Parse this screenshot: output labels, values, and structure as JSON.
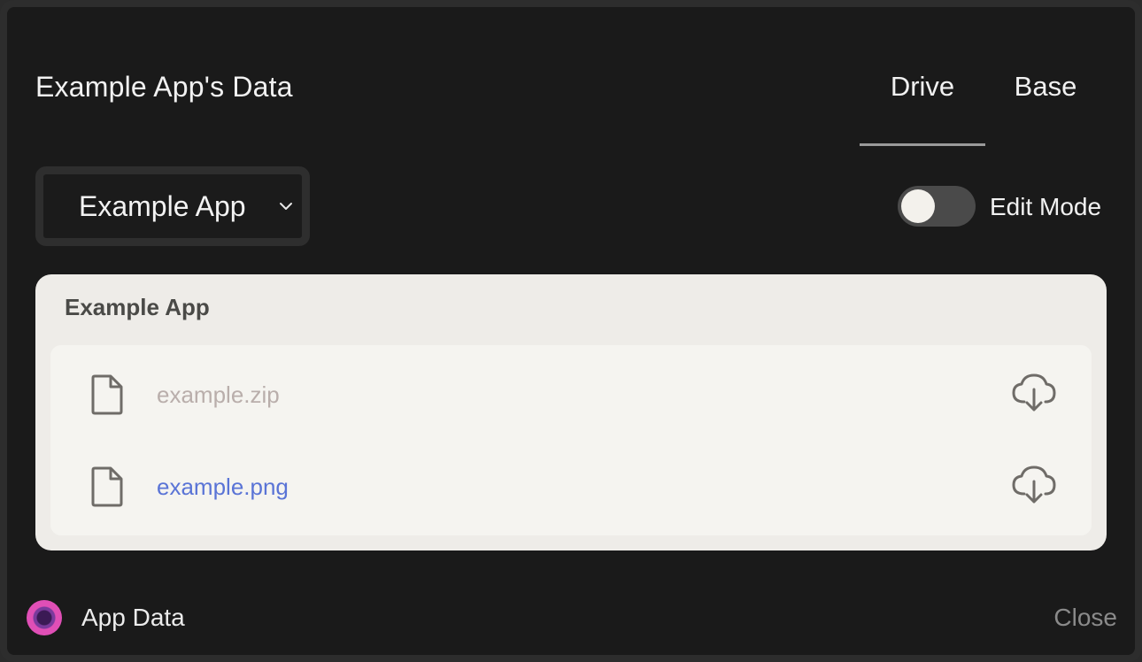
{
  "header": {
    "title": "Example App's Data",
    "tabs": [
      {
        "label": "Drive",
        "active": true
      },
      {
        "label": "Base",
        "active": false
      }
    ]
  },
  "controls": {
    "app_select": {
      "selected": "Example App",
      "icon": "chevron-down-icon"
    },
    "edit_mode": {
      "label": "Edit Mode",
      "enabled": false
    }
  },
  "panel": {
    "title": "Example App",
    "files": [
      {
        "name": "example.zip",
        "color": "#b9aeab",
        "icon": "file-icon",
        "action_icon": "cloud-download-icon"
      },
      {
        "name": "example.png",
        "color": "#5a74d6",
        "icon": "file-icon",
        "action_icon": "cloud-download-icon"
      }
    ]
  },
  "footer": {
    "label": "App Data",
    "close_label": "Close"
  }
}
